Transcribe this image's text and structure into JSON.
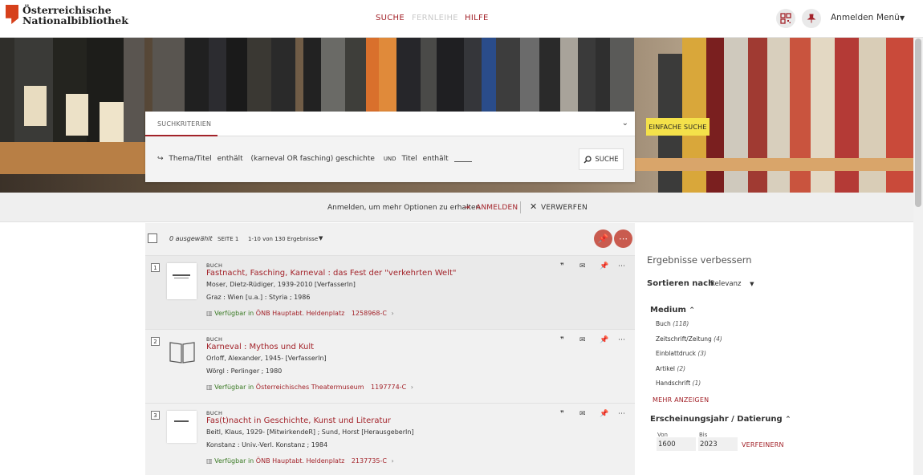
{
  "brand": {
    "line1": "Österreichische",
    "line2": "Nationalbibliothek"
  },
  "nav": {
    "search": "SUCHE",
    "interlibrary": "FERNLEIHE",
    "help": "HILFE"
  },
  "header": {
    "login": "Anmelden",
    "menu": "Menü"
  },
  "search": {
    "tab": "SUCHKRITERIEN",
    "field1": "Thema/Titel",
    "op1": "enthält",
    "value1": "(karneval OR fasching) geschichte",
    "connector": "UND",
    "field2": "Titel",
    "op2": "enthält",
    "button": "SUCHE",
    "simple": "EINFACHE SUCHE"
  },
  "loginbar": {
    "text": "Anmelden, um mehr Optionen zu erhalten",
    "login": "ANMELDEN",
    "dismiss": "VERWERFEN"
  },
  "results_header": {
    "selected": "0 ausgewählt",
    "page": "SEITE 1",
    "range": "1-10 von 130 Ergebnisse"
  },
  "results": [
    {
      "num": "1",
      "type": "BUCH",
      "title": "Fastnacht, Fasching, Karneval : das Fest der \"verkehrten Welt\"",
      "author": "Moser, Dietz-Rüdiger, 1939-2010 [VerfasserIn]",
      "pub": "Graz : Wien [u.a.] : Styria ; 1986",
      "avail": "Verfügbar in",
      "location": "ÖNB Hauptabt. Heldenplatz",
      "signature": "1258968-C"
    },
    {
      "num": "2",
      "type": "BUCH",
      "title": "Karneval : Mythos und Kult",
      "author": "Orloff, Alexander, 1945- [VerfasserIn]",
      "pub": "Wörgl : Perlinger ; 1980",
      "avail": "Verfügbar in",
      "location": "Österreichisches Theatermuseum",
      "signature": "1197774-C"
    },
    {
      "num": "3",
      "type": "BUCH",
      "title": "Fas(t)nacht in Geschichte, Kunst und Literatur",
      "author": "Beitl, Klaus, 1929- [MitwirkendeR] ; Sund, Horst [HerausgeberIn]",
      "pub": "Konstanz : Univ.-Verl. Konstanz ; 1984",
      "avail": "Verfügbar in",
      "location": "ÖNB Hauptabt. Heldenplatz",
      "signature": "2137735-C"
    }
  ],
  "sidebar": {
    "heading": "Ergebnisse verbessern",
    "sort_label": "Sortieren nach",
    "sort_value": "Relevanz",
    "medium_heading": "Medium",
    "medium": [
      {
        "label": "Buch",
        "count": "(118)"
      },
      {
        "label": "Zeitschrift/Zeitung",
        "count": "(4)"
      },
      {
        "label": "Einblattdruck",
        "count": "(3)"
      },
      {
        "label": "Artikel",
        "count": "(2)"
      },
      {
        "label": "Handschrift",
        "count": "(1)"
      }
    ],
    "more": "MEHR ANZEIGEN",
    "year_heading": "Erscheinungsjahr / Datierung",
    "from_label": "Von",
    "to_label": "Bis",
    "from_value": "1600",
    "to_value": "2023",
    "refine": "VERFEINERN"
  },
  "colors": {
    "accent": "#a3232a",
    "available": "#3a7a24",
    "highlight": "#f4e14a"
  },
  "icons": [
    "qr-code-icon",
    "pin-icon",
    "caret-down-icon",
    "chevron-down-icon",
    "search-icon",
    "login-icon",
    "close-icon",
    "quote-icon",
    "mail-icon",
    "more-icon",
    "availability-icon",
    "chevron-right-icon",
    "chevron-up-icon"
  ]
}
